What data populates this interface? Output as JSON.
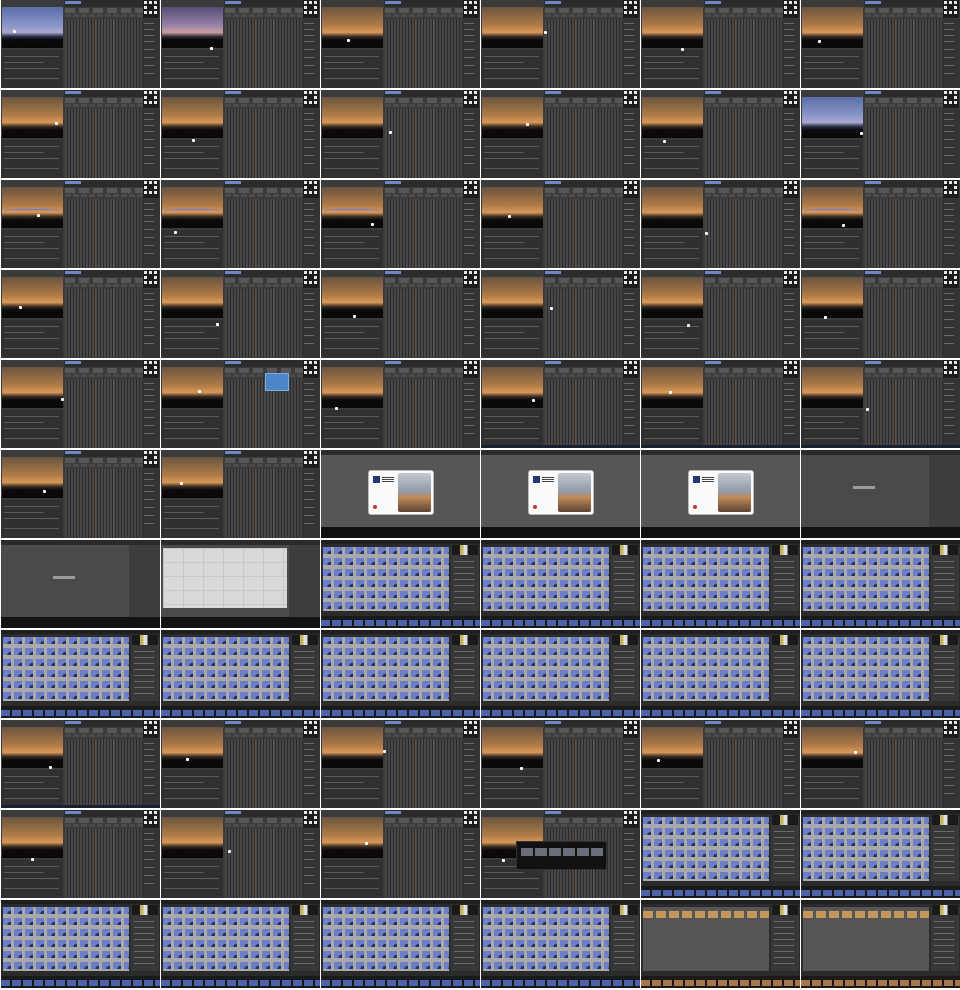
{
  "screenshot": {
    "layout": "contact-sheet",
    "columns": 6,
    "rows": 11,
    "tiles": [
      {
        "kind": "timelapse",
        "sky": "blue"
      },
      {
        "kind": "timelapse",
        "sky": "dusk"
      },
      {
        "kind": "timelapse"
      },
      {
        "kind": "timelapse"
      },
      {
        "kind": "timelapse"
      },
      {
        "kind": "timelapse"
      },
      {
        "kind": "timelapse"
      },
      {
        "kind": "timelapse"
      },
      {
        "kind": "timelapse"
      },
      {
        "kind": "timelapse"
      },
      {
        "kind": "timelapse"
      },
      {
        "kind": "timelapse",
        "sky": "blue"
      },
      {
        "kind": "timelapse",
        "curve": true
      },
      {
        "kind": "timelapse",
        "curve": true
      },
      {
        "kind": "timelapse",
        "curve": true
      },
      {
        "kind": "timelapse"
      },
      {
        "kind": "timelapse"
      },
      {
        "kind": "timelapse",
        "curve": true
      },
      {
        "kind": "timelapse"
      },
      {
        "kind": "timelapse"
      },
      {
        "kind": "timelapse"
      },
      {
        "kind": "timelapse"
      },
      {
        "kind": "timelapse"
      },
      {
        "kind": "timelapse"
      },
      {
        "kind": "timelapse"
      },
      {
        "kind": "timelapse"
      },
      {
        "kind": "timelapse"
      },
      {
        "kind": "timelapse",
        "taskbar": true
      },
      {
        "kind": "timelapse",
        "taskbar": true
      },
      {
        "kind": "timelapse",
        "taskbar": true
      },
      {
        "kind": "timelapse"
      },
      {
        "kind": "timelapse"
      },
      {
        "kind": "dialog"
      },
      {
        "kind": "dialog"
      },
      {
        "kind": "dialog"
      },
      {
        "kind": "empty"
      },
      {
        "kind": "empty"
      },
      {
        "kind": "empty",
        "light": true
      },
      {
        "kind": "library"
      },
      {
        "kind": "library"
      },
      {
        "kind": "library"
      },
      {
        "kind": "library"
      },
      {
        "kind": "library"
      },
      {
        "kind": "library"
      },
      {
        "kind": "library"
      },
      {
        "kind": "library"
      },
      {
        "kind": "library"
      },
      {
        "kind": "library"
      },
      {
        "kind": "timelapse",
        "taskbar": true
      },
      {
        "kind": "timelapse"
      },
      {
        "kind": "timelapse"
      },
      {
        "kind": "timelapse"
      },
      {
        "kind": "timelapse"
      },
      {
        "kind": "timelapse"
      },
      {
        "kind": "timelapse"
      },
      {
        "kind": "timelapse"
      },
      {
        "kind": "timelapse"
      },
      {
        "kind": "timelapse"
      },
      {
        "kind": "library"
      },
      {
        "kind": "library"
      },
      {
        "kind": "library"
      },
      {
        "kind": "library"
      },
      {
        "kind": "library"
      },
      {
        "kind": "library"
      },
      {
        "kind": "library",
        "warm": true
      },
      {
        "kind": "library",
        "warm": true
      }
    ]
  },
  "colors": {
    "background": "#ffffff",
    "panel": "#3b3b3b",
    "accent_blue": "#5a7ff0",
    "sky_warm": "#d8995a"
  },
  "icons": [
    "app-logo-icon",
    "mouse-cursor-icon"
  ]
}
